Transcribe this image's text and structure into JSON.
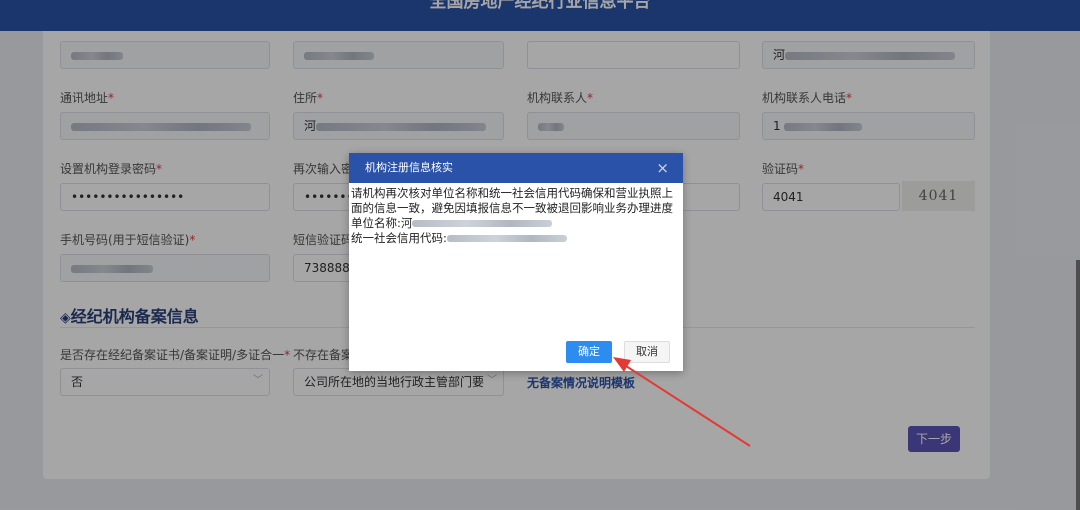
{
  "app": {
    "title": "全国房地产经纪行业信息平台"
  },
  "form": {
    "labels": {
      "address": "通讯地址",
      "residence": "住所",
      "contact": "机构联系人",
      "contact_phone": "机构联系人电话",
      "password": "设置机构登录密码",
      "password_confirm": "再次输入密",
      "captcha": "验证码",
      "mobile": "手机号码(用于短信验证)",
      "sms_code": "短信验证码",
      "has_cert": "是否存在经纪备案证书/备案证明/多证合一",
      "no_cert": "不存在备案"
    },
    "values": {
      "row1_c4_prefix": "河",
      "residence_prefix": "河",
      "contact_phone_prefix": "1",
      "password_mask": "••••••••••••••••",
      "password_confirm_mask": "••••••••",
      "captcha_value": "4041",
      "captcha_image_text": "4041",
      "sms_code_value": "738888",
      "has_cert_value": "否",
      "no_cert_value": "公司所在地的当地行政主管部门要"
    },
    "required_mark": "*"
  },
  "section": {
    "title": "经纪机构备案信息"
  },
  "link": {
    "text": "无备案情况说明模板"
  },
  "next_button": "下一步",
  "dialog": {
    "title": "机构注册信息核实",
    "close": "×",
    "line1": "请机构再次核对单位名称和统一社会信用代码确保和营业执照上面的信息一致，避免因填报信息不一致被退回影响业务办理进度",
    "unit_name_label": "单位名称:",
    "unit_name_prefix": "河",
    "credit_code_label": "统一社会信用代码:",
    "ok": "确定",
    "cancel": "取消"
  },
  "colors": {
    "brand": "#2a52a8",
    "primary_button": "#2d8cf0",
    "next_button": "#5b54b8",
    "required": "#e4393c",
    "arrow": "#e53935"
  }
}
